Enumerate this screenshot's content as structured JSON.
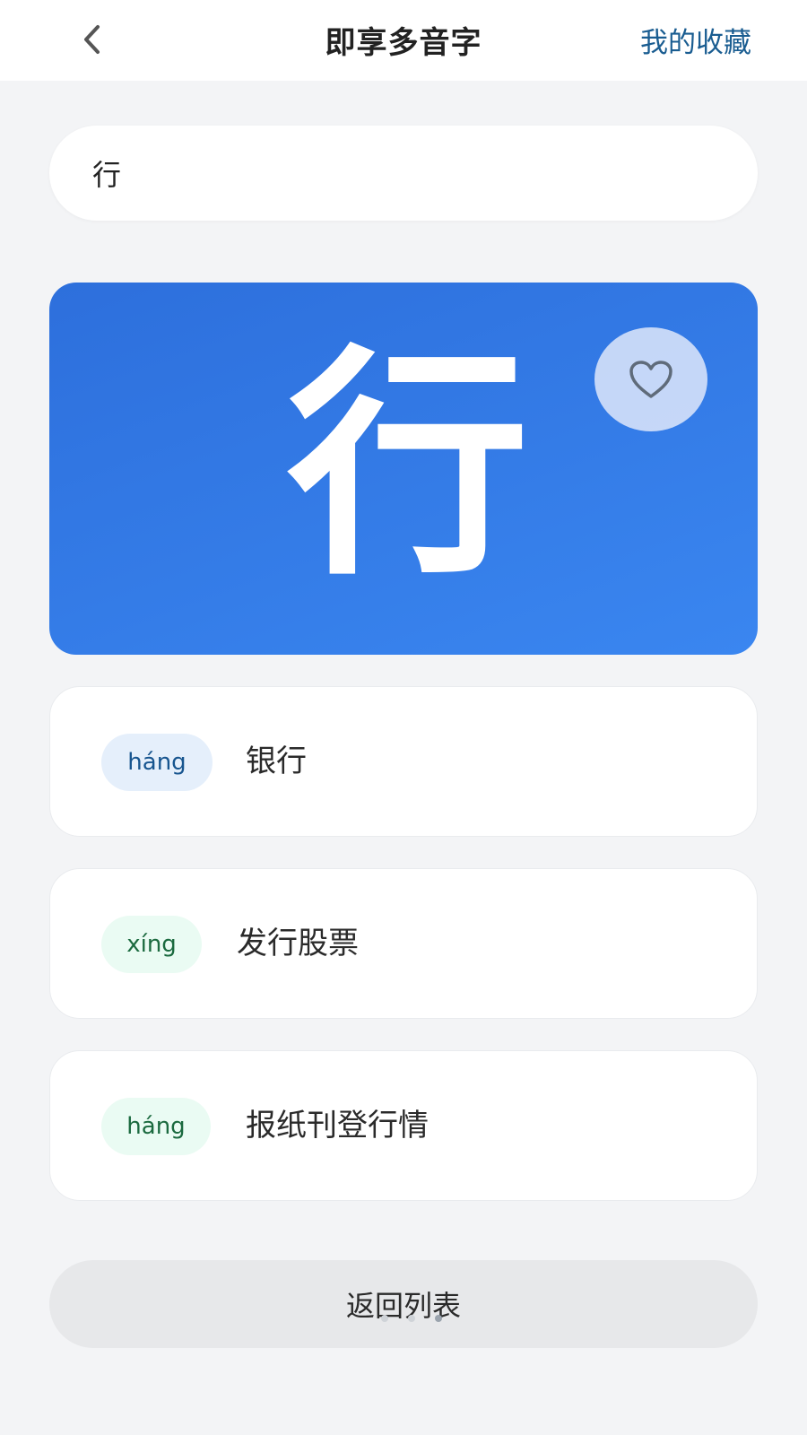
{
  "header": {
    "title": "即享多音字",
    "favorites_label": "我的收藏",
    "back_icon": "chevron-left-icon"
  },
  "search": {
    "value": "行"
  },
  "hero": {
    "character": "行",
    "favorite_icon": "heart-icon"
  },
  "pronunciations": [
    {
      "pinyin": "háng",
      "word": "银行",
      "pill_color": "#e5effb"
    },
    {
      "pinyin": "xíng",
      "word": "发行股票",
      "pill_color": "#eafbf3"
    },
    {
      "pinyin": "háng",
      "word": "报纸刊登行情",
      "pill_color": "#eafbf3"
    }
  ],
  "footer": {
    "return_label": "返回列表",
    "page_indicator": {
      "total": 3,
      "active": 3
    }
  },
  "colors": {
    "accent": "#1a5d91",
    "hero_gradient_start": "#2d6fdc",
    "hero_gradient_end": "#3a86f0",
    "background": "#f3f4f6"
  }
}
